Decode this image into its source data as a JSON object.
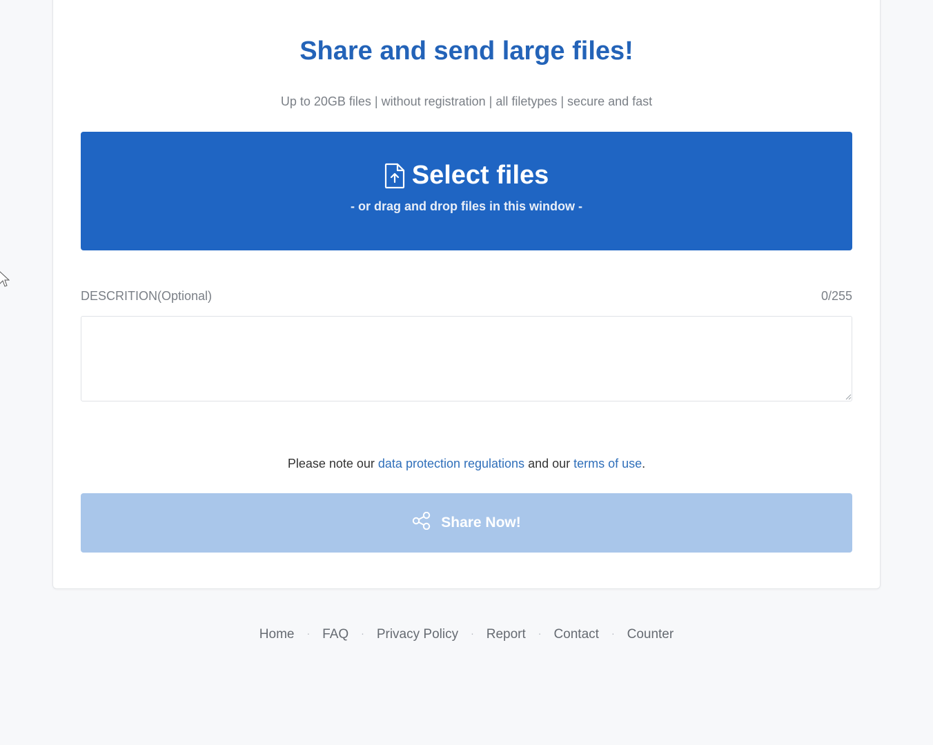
{
  "header": {
    "title": "Share and send large files!",
    "subtitle": "Up to 20GB files | without registration | all filetypes | secure and fast"
  },
  "upload": {
    "select_label": "Select files",
    "drag_hint": "- or drag and drop files in this window -",
    "icon": "file-upload-icon"
  },
  "description": {
    "label": "DESCRITION(Optional)",
    "counter": "0/255",
    "value": "",
    "placeholder": ""
  },
  "notice": {
    "prefix": "Please note our ",
    "link1": "data protection regulations",
    "middle": " and our ",
    "link2": "terms of use",
    "suffix": "."
  },
  "share": {
    "label": "Share Now!",
    "icon": "share-icon",
    "enabled": false
  },
  "footer": {
    "links": [
      "Home",
      "FAQ",
      "Privacy Policy",
      "Report",
      "Contact",
      "Counter"
    ],
    "separator": "·"
  },
  "colors": {
    "primary": "#1f65c3",
    "title": "#2363b8",
    "share_disabled": "#a9c6ea",
    "link": "#2f6fba"
  }
}
